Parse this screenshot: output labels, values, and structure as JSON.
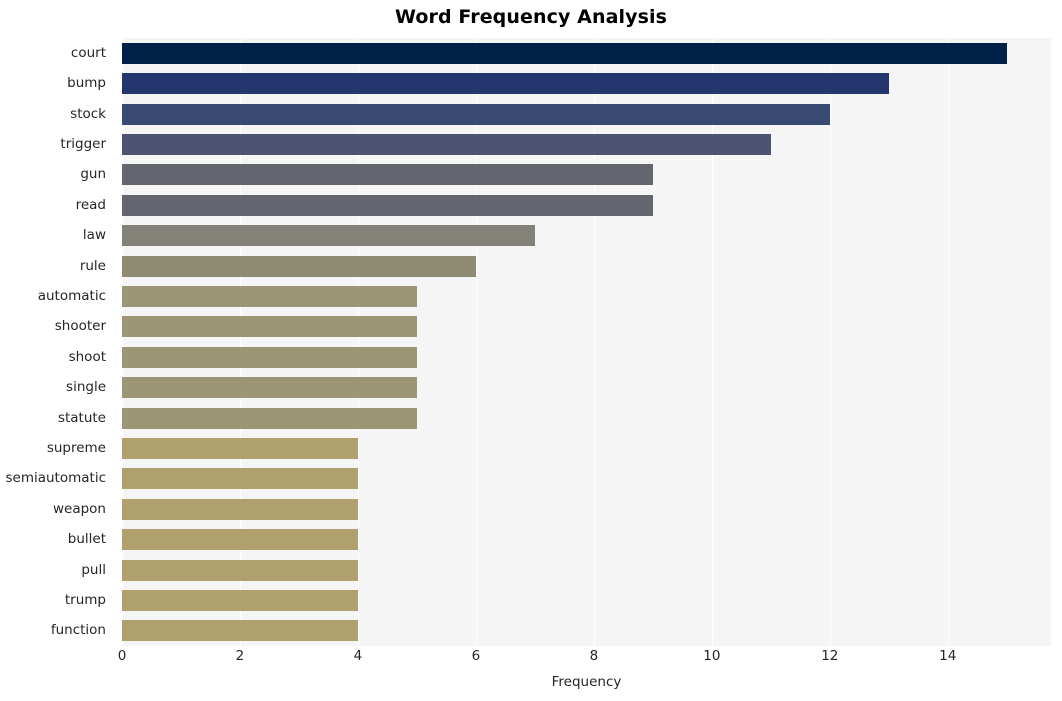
{
  "chart_data": {
    "type": "bar",
    "orientation": "horizontal",
    "title": "Word Frequency Analysis",
    "xlabel": "Frequency",
    "ylabel": "",
    "categories": [
      "court",
      "bump",
      "stock",
      "trigger",
      "gun",
      "read",
      "law",
      "rule",
      "automatic",
      "shooter",
      "shoot",
      "single",
      "statute",
      "supreme",
      "semiautomatic",
      "weapon",
      "bullet",
      "pull",
      "trump",
      "function"
    ],
    "values": [
      15,
      13,
      12,
      11,
      9,
      9,
      7,
      6,
      5,
      5,
      5,
      5,
      5,
      4,
      4,
      4,
      4,
      4,
      4,
      4
    ],
    "bar_colors": [
      "#002147",
      "#23376e",
      "#394a72",
      "#4d5471",
      "#64666f",
      "#64666f",
      "#838178",
      "#8e8b72",
      "#9c9677",
      "#9c9677",
      "#9c9677",
      "#9c9677",
      "#9c9677",
      "#b0a06e",
      "#b0a06e",
      "#b0a06e",
      "#b0a06e",
      "#b0a06e",
      "#b0a06e",
      "#b0a06e"
    ],
    "xticks": [
      0,
      2,
      4,
      6,
      8,
      10,
      12,
      14
    ],
    "xtick_labels": [
      "0",
      "2",
      "4",
      "6",
      "8",
      "10",
      "12",
      "14"
    ],
    "xlim": [
      0,
      15.75
    ],
    "grid": true,
    "grid_axis": "x",
    "grid_color": "#ffffff",
    "plot_background": "#f5f5f6",
    "figure_background": "#ffffff",
    "legend": null
  }
}
